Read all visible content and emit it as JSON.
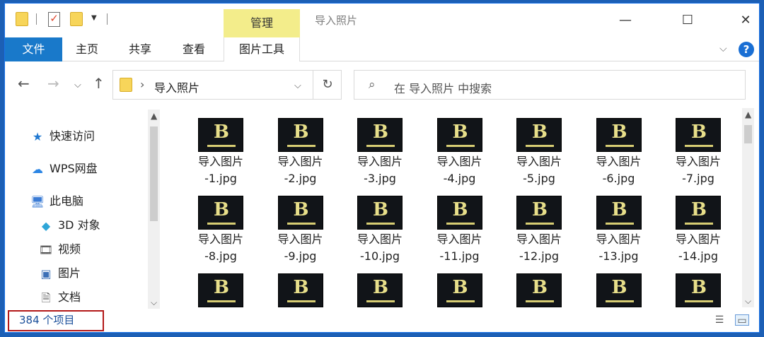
{
  "titlebar": {
    "manage_tab": "管理",
    "title": "导入照片",
    "controls": {
      "minimize": "—",
      "maximize": "☐",
      "close": "✕"
    }
  },
  "ribbon": {
    "file": "文件",
    "tabs": [
      "主页",
      "共享",
      "查看"
    ],
    "tools": "图片工具"
  },
  "address": {
    "separator": "›",
    "path": "导入照片",
    "search_placeholder": "在 导入照片 中搜索"
  },
  "nav": {
    "items": [
      {
        "label": "快速访问",
        "icon": "star-icon"
      },
      {
        "label": "WPS网盘",
        "icon": "cloud-icon"
      },
      {
        "label": "此电脑",
        "icon": "pc-icon"
      },
      {
        "label": "3D 对象",
        "icon": "cube-icon"
      },
      {
        "label": "视频",
        "icon": "video-icon"
      },
      {
        "label": "图片",
        "icon": "picture-icon"
      },
      {
        "label": "文档",
        "icon": "document-icon"
      }
    ]
  },
  "files": [
    {
      "line1": "导入图片",
      "line2": "-1.jpg"
    },
    {
      "line1": "导入图片",
      "line2": "-2.jpg"
    },
    {
      "line1": "导入图片",
      "line2": "-3.jpg"
    },
    {
      "line1": "导入图片",
      "line2": "-4.jpg"
    },
    {
      "line1": "导入图片",
      "line2": "-5.jpg"
    },
    {
      "line1": "导入图片",
      "line2": "-6.jpg"
    },
    {
      "line1": "导入图片",
      "line2": "-7.jpg"
    },
    {
      "line1": "导入图片",
      "line2": "-8.jpg"
    },
    {
      "line1": "导入图片",
      "line2": "-9.jpg"
    },
    {
      "line1": "导入图片",
      "line2": "-10.jpg"
    },
    {
      "line1": "导入图片",
      "line2": "-11.jpg"
    },
    {
      "line1": "导入图片",
      "line2": "-12.jpg"
    },
    {
      "line1": "导入图片",
      "line2": "-13.jpg"
    },
    {
      "line1": "导入图片",
      "line2": "-14.jpg"
    },
    {
      "line1": "",
      "line2": ""
    },
    {
      "line1": "",
      "line2": ""
    },
    {
      "line1": "",
      "line2": ""
    },
    {
      "line1": "",
      "line2": ""
    },
    {
      "line1": "",
      "line2": ""
    },
    {
      "line1": "",
      "line2": ""
    },
    {
      "line1": "",
      "line2": ""
    }
  ],
  "status": {
    "count": "384 个项目"
  },
  "colors": {
    "accent": "#1979ca",
    "manage_tab": "#f3ed8b",
    "highlight_box": "#b31818"
  }
}
